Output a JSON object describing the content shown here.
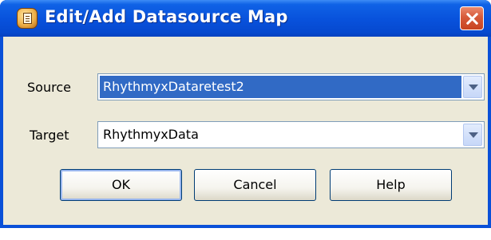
{
  "window": {
    "title": "Edit/Add Datasource Map",
    "icon": "datasource-map-icon",
    "close_icon": "close-icon"
  },
  "form": {
    "source_label": "Source",
    "source_value": "RhythmyxDataretest2",
    "target_label": "Target",
    "target_value": "RhythmyxData",
    "dropdown_icon": "chevron-down-icon"
  },
  "buttons": {
    "ok": "OK",
    "cancel": "Cancel",
    "help": "Help"
  },
  "colors": {
    "titlebar": "#0851db",
    "close": "#d65a3a",
    "dialog_bg": "#ece9d8",
    "selection": "#316ac5"
  }
}
